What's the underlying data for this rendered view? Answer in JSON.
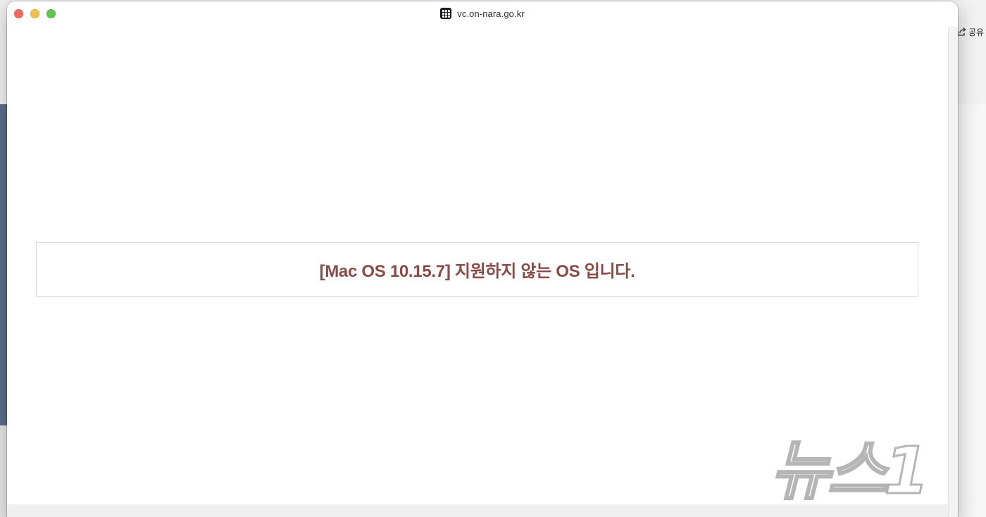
{
  "window": {
    "url": "vc.on-nara.go.kr",
    "site_icon": "grid-app-icon"
  },
  "background": {
    "share_label": "공유"
  },
  "notice": {
    "message": "[Mac OS 10.15.7] 지원하지 않는 OS 입니다."
  },
  "watermark": {
    "text": "뉴스1"
  },
  "colors": {
    "notice_text": "#8a4a46",
    "close": "#ed6a5e",
    "minimize": "#f5bf4f",
    "maximize": "#61c554",
    "left_panel": "#5b6e8e"
  }
}
